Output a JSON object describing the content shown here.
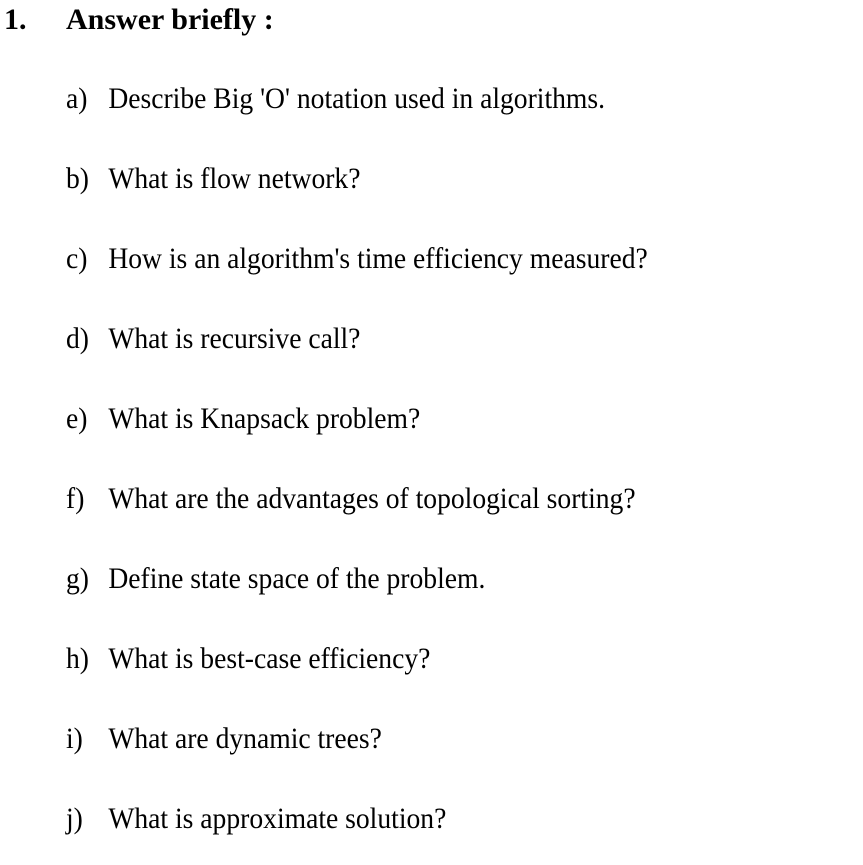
{
  "question": {
    "number": "1.",
    "title": "Answer briefly :"
  },
  "items": [
    {
      "label": "a)",
      "text": "Describe Big 'O' notation used in algorithms."
    },
    {
      "label": "b)",
      "text": "What is flow network?"
    },
    {
      "label": "c)",
      "text": "How is an algorithm's time efficiency measured?"
    },
    {
      "label": "d)",
      "text": "What is recursive call?"
    },
    {
      "label": "e)",
      "text": "What is Knapsack problem?"
    },
    {
      "label": "f)",
      "text": "What are the advantages of topological sorting?"
    },
    {
      "label": "g)",
      "text": "Define state space of the problem."
    },
    {
      "label": "h)",
      "text": "What is best-case efficiency?"
    },
    {
      "label": "i)",
      "text": "What are dynamic trees?"
    },
    {
      "label": "j)",
      "text": "What is approximate solution?"
    }
  ]
}
